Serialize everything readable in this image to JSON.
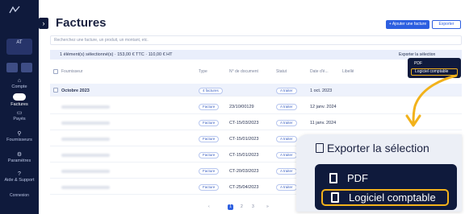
{
  "sidebar": {
    "avatar": "AT",
    "items": [
      {
        "label": "Compte",
        "icon": "bank-icon"
      },
      {
        "label": "Factures",
        "icon": "invoice-icon",
        "active": true
      },
      {
        "label": "Payés",
        "icon": "paid-icon"
      },
      {
        "label": "Fournisseurs",
        "icon": "search-icon"
      },
      {
        "label": "Paramètres",
        "icon": "settings-icon"
      },
      {
        "label": "Aide & Support",
        "icon": "help-icon"
      }
    ],
    "bottom": "Connexion"
  },
  "header": {
    "title": "Factures",
    "add_button": "+ Ajouter une facture",
    "export_button": "Exporter"
  },
  "search": {
    "placeholder": "Recherchez une facture, un produit, un montant, etc."
  },
  "selection_bar": {
    "text": "1 élément(s) sélectionné(s) · 153,00 € TTC · 110,00 € HT",
    "export_label": "Exporter la sélection"
  },
  "mini_dropdown": {
    "options": [
      "PDF",
      "Logiciel comptable"
    ]
  },
  "table": {
    "columns": [
      "Fournisseur",
      "Type",
      "N° de document",
      "Statut",
      "Date d'é...",
      "Libellé"
    ],
    "group_row": {
      "label": "Octobre 2023",
      "type": "4 factures",
      "status": "A traiter",
      "date": "1 oct. 2023"
    },
    "rows": [
      {
        "type": "Facture",
        "doc": "23/10/00129",
        "status": "A traiter",
        "date": "12 janv. 2024"
      },
      {
        "type": "Facture",
        "doc": "CT-15/03/2023",
        "status": "A traiter",
        "date": "11 janv. 2024"
      },
      {
        "type": "Facture",
        "doc": "CT-15/01/2023",
        "status": "A traiter",
        "date": ""
      },
      {
        "type": "Facture",
        "doc": "CT-15/01/2023",
        "status": "A traiter",
        "date": ""
      },
      {
        "type": "Facture",
        "doc": "CT-20/03/2023",
        "status": "A traiter",
        "date": ""
      },
      {
        "type": "Facture",
        "doc": "CT-25/04/2023",
        "status": "A traiter",
        "date": ""
      }
    ]
  },
  "pager": {
    "pages": [
      "‹",
      "1",
      "2",
      "3",
      "»"
    ],
    "current": "1"
  },
  "zoom": {
    "title": "Exporter la sélection",
    "options": [
      "PDF",
      "Logiciel comptable"
    ],
    "highlight_color": "#f2b21b"
  }
}
